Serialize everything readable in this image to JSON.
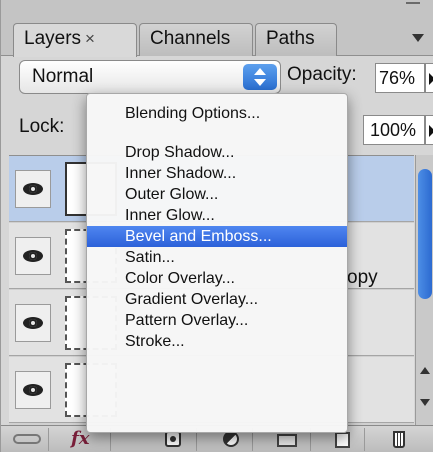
{
  "tabs": [
    {
      "label": "Layers",
      "close_glyph": "×",
      "active": true
    },
    {
      "label": "Channels",
      "active": false
    },
    {
      "label": "Paths",
      "active": false
    }
  ],
  "blend": {
    "mode": "Normal"
  },
  "opacity": {
    "label": "Opacity:",
    "value": "76%"
  },
  "lock": {
    "label": "Lock:"
  },
  "fill": {
    "value": "100%"
  },
  "layers": [
    {
      "name": "",
      "visible": true,
      "selected": true
    },
    {
      "name": "…opy",
      "visible": true,
      "selected": false
    },
    {
      "name": "",
      "visible": true,
      "selected": false
    },
    {
      "name": "",
      "visible": true,
      "selected": false
    }
  ],
  "layer_text_fragment": "opy",
  "context_menu": {
    "blending_options": "Blending Options...",
    "effects": [
      "Drop Shadow...",
      "Inner Shadow...",
      "Outer Glow...",
      "Inner Glow...",
      "Bevel and Emboss...",
      "Satin...",
      "Color Overlay...",
      "Gradient Overlay...",
      "Pattern Overlay...",
      "Stroke..."
    ],
    "highlighted": "Bevel and Emboss..."
  },
  "bottom_bar": {
    "fx_label": "fx",
    "icons": [
      "link-layers-icon",
      "fx-icon",
      "layer-mask-icon",
      "adjustment-layer-icon",
      "group-folder-icon",
      "new-layer-icon",
      "trash-icon"
    ]
  },
  "colors": {
    "highlight": "#2c61d9",
    "selected_layer": "#b9cdea",
    "fx_icon": "#7a1f3a"
  }
}
